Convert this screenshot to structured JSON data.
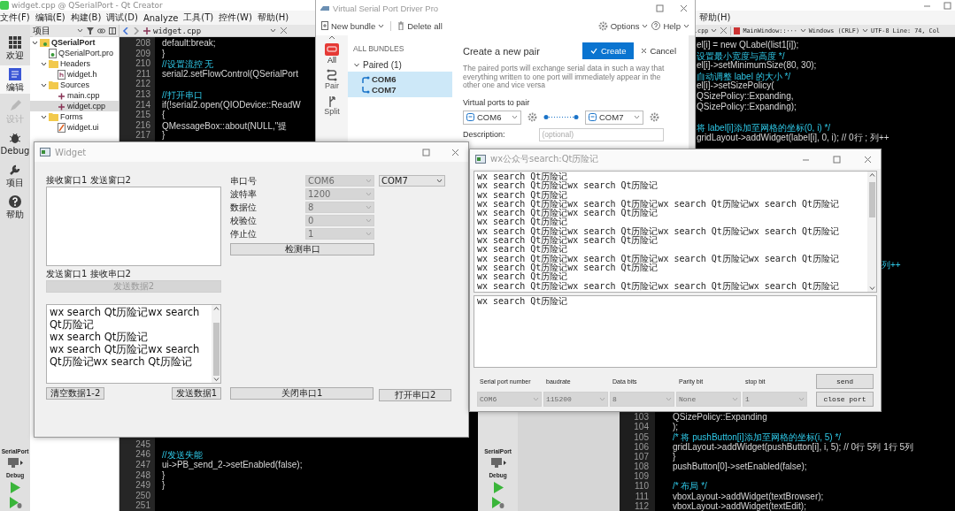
{
  "ide_left": {
    "title": "widget.cpp @ QSerialPort - Qt Creator",
    "menu": [
      "文件(F)",
      "编辑(E)",
      "构建(B)",
      "调试(D)",
      "Analyze",
      "工具(T)",
      "控件(W)",
      "帮助(H)"
    ],
    "modes": [
      {
        "label": "欢迎",
        "selected": false,
        "disabled": false
      },
      {
        "label": "编辑",
        "selected": true,
        "disabled": false
      },
      {
        "label": "设计",
        "selected": false,
        "disabled": true
      },
      {
        "label": "Debug",
        "selected": false,
        "disabled": false
      },
      {
        "label": "项目",
        "selected": false,
        "disabled": false
      },
      {
        "label": "帮助",
        "selected": false,
        "disabled": false
      }
    ],
    "project_view": "项目",
    "editor_file": "widget.cpp",
    "tree": [
      {
        "label": "QSerialPort",
        "kind": "project",
        "expanded": true,
        "selected": false,
        "children": [
          {
            "label": "QSerialPort.pro",
            "kind": "pro",
            "selected": false
          },
          {
            "label": "Headers",
            "kind": "folder",
            "expanded": true,
            "selected": false,
            "children": [
              {
                "label": "widget.h",
                "kind": "header",
                "selected": false
              }
            ]
          },
          {
            "label": "Sources",
            "kind": "folder",
            "expanded": true,
            "selected": false,
            "children": [
              {
                "label": "main.cpp",
                "kind": "source",
                "selected": false
              },
              {
                "label": "widget.cpp",
                "kind": "source",
                "selected": true
              }
            ]
          },
          {
            "label": "Forms",
            "kind": "folder",
            "expanded": true,
            "selected": false,
            "children": [
              {
                "label": "widget.ui",
                "kind": "form",
                "selected": false
              }
            ]
          }
        ]
      }
    ],
    "code_top": [
      {
        "number": "208",
        "kind": "code",
        "text": "default:break;"
      },
      {
        "number": "209",
        "kind": "code",
        "text": "}"
      },
      {
        "number": "210",
        "kind": "comment",
        "text": "//设置流控 无"
      },
      {
        "number": "211",
        "kind": "code",
        "text": "serial2.setFlowControl(QSerialPort"
      },
      {
        "number": "212",
        "kind": "blank"
      },
      {
        "number": "213",
        "kind": "comment",
        "text": "//打开串口"
      },
      {
        "number": "214",
        "kind": "code",
        "text": "if(!serial2.open(QIODevice::ReadW"
      },
      {
        "number": "215",
        "kind": "code",
        "text": "{"
      },
      {
        "number": "216",
        "kind": "code",
        "text": "QMessageBox::about(NULL,\"提"
      },
      {
        "number": "217",
        "kind": "code",
        "text": "}"
      }
    ],
    "code_bottom": [
      {
        "number": "245",
        "kind": "blank"
      },
      {
        "number": "246",
        "kind": "comment",
        "text": "//发送失能"
      },
      {
        "number": "247",
        "kind": "code",
        "text": "ui->PB_send_2->setEnabled(false);"
      },
      {
        "number": "248",
        "kind": "code",
        "text": "}"
      },
      {
        "number": "249",
        "kind": "code",
        "text": "}"
      },
      {
        "number": "250",
        "kind": "blank"
      },
      {
        "number": "251",
        "kind": "blank"
      }
    ],
    "kit": {
      "project": "SerialPort",
      "build": "Debug"
    }
  },
  "ide_right": {
    "menu": [
      "帮助(H)"
    ],
    "file_tab": ".cpp",
    "symbol": "MainWindow::···",
    "line_ending": "Windows (CRLF)",
    "position": "UTF-8 Line: 74, Col",
    "code_top": [
      {
        "kind": "code",
        "text": "el[i] = new QLabel(list1[i]);"
      },
      {
        "kind": "comment",
        "text": "设置最小宽度与高度 */"
      },
      {
        "kind": "code",
        "text": "el[i]->setMinimumSize(80, 30);"
      },
      {
        "kind": "comment",
        "text": "自动调整 label 的大小 */"
      },
      {
        "kind": "code",
        "text": "el[i]->setSizePolicy("
      },
      {
        "kind": "code",
        "text": "QSizePolicy::Expanding,"
      },
      {
        "kind": "code",
        "text": "QSizePolicy::Expanding);"
      },
      {
        "kind": "blank"
      },
      {
        "kind": "comment",
        "text": "将 label[i]添加至网格的坐标(0, i) */"
      },
      {
        "kind": "code",
        "text": "gridLayout->addWidget(label[i], 0, i); // 0行 ; 列++"
      }
    ],
    "fragment": "列++",
    "code_bottom": [
      {
        "number": "103",
        "kind": "code",
        "text": "QSizePolicy::Expanding"
      },
      {
        "number": "104",
        "kind": "code",
        "text": ");"
      },
      {
        "number": "105",
        "kind": "comment",
        "text": "/* 将 pushButton[i]添加至网格的坐标(i, 5) */"
      },
      {
        "number": "106",
        "kind": "code",
        "text": "gridLayout->addWidget(pushButton[i], i, 5); // 0行 5列 1行 5列"
      },
      {
        "number": "107",
        "kind": "code",
        "text": "}"
      },
      {
        "number": "108",
        "kind": "code",
        "text": "pushButton[0]->setEnabled(false);"
      },
      {
        "number": "109",
        "kind": "blank"
      },
      {
        "number": "110",
        "kind": "comment",
        "text": "/* 布局 */"
      },
      {
        "number": "111",
        "kind": "code",
        "text": "vboxLayout->addWidget(textBrowser);"
      },
      {
        "number": "112",
        "kind": "code",
        "text": "vboxLayout->addWidget(textEdit);"
      }
    ],
    "kit": {
      "project": "SerialPort",
      "build": "Debug"
    }
  },
  "vspd": {
    "title": "Virtual Serial Port Driver Pro",
    "new_bundle": "New bundle",
    "delete_all": "Delete all",
    "options": "Options",
    "help": "Help",
    "nav": [
      {
        "label": "All",
        "selected": true
      },
      {
        "label": "Pair",
        "selected": false
      },
      {
        "label": "Split",
        "selected": false
      }
    ],
    "bundles_heading": "ALL BUNDLES",
    "bundle": {
      "label": "Paired (1)",
      "expanded": true,
      "selected": true,
      "ports": [
        "COM6",
        "COM7"
      ]
    },
    "heading": "Create a new pair",
    "create": "Create",
    "cancel": "Cancel",
    "description": "The paired ports will exchange serial data in such a way that everything written to one port will immediately appear in the other one and vice versa",
    "ports_label": "Virtual ports to pair",
    "port_a": "COM6",
    "port_b": "COM7",
    "description_label": "Description:",
    "description_placeholder": "(optional)"
  },
  "widget": {
    "title": "Widget",
    "receive_label": "接收窗口1 发送窗口2",
    "send_label": "发送窗口1 接收串口2",
    "send2": {
      "label": "发送数据2",
      "disabled": true
    },
    "text_edit": [
      "wx search Qt历险记wx search Qt历险记",
      "wx search Qt历险记",
      "wx search Qt历险记wx search Qt历险记wx search Qt历险记"
    ],
    "settings": [
      {
        "label": "串口号",
        "value": "COM6",
        "disabled": true
      },
      {
        "label": "波特率",
        "value": "1200",
        "disabled": true
      },
      {
        "label": "数据位",
        "value": "8",
        "disabled": true
      },
      {
        "label": "校验位",
        "value": "0",
        "disabled": true
      },
      {
        "label": "停止位",
        "value": "1",
        "disabled": true
      }
    ],
    "port2": {
      "value": "COM7",
      "disabled": false
    },
    "detect": "检测串口",
    "clear": "清空数据1-2",
    "send1": "发送数据1",
    "close1": "关闭串口1",
    "open2": "打开串口2"
  },
  "wx": {
    "title": "wx公众号search:Qt历险记",
    "received": [
      "wx search Qt历险记",
      "wx search Qt历险记wx search Qt历险记",
      "wx search Qt历险记",
      "wx search Qt历险记wx search Qt历险记wx search Qt历险记wx search Qt历险记",
      "wx search Qt历险记wx search Qt历险记",
      "wx search Qt历险记",
      "wx search Qt历险记wx search Qt历险记wx search Qt历险记wx search Qt历险记",
      "wx search Qt历险记wx search Qt历险记",
      "wx search Qt历险记",
      "wx search Qt历险记wx search Qt历险记wx search Qt历险记wx search Qt历险记",
      "wx search Qt历险记wx search Qt历险记",
      "wx search Qt历险记",
      "wx search Qt历险记wx search Qt历险记wx search Qt历险记wx search Qt历险记"
    ],
    "input": "wx search Qt历险记",
    "fields": [
      {
        "label": "Serial port number",
        "value": "COM6",
        "disabled": true
      },
      {
        "label": "baudrate",
        "value": "115200",
        "disabled": true
      },
      {
        "label": "Data bits",
        "value": "8",
        "disabled": true
      },
      {
        "label": "Parity bit",
        "value": "None",
        "disabled": true
      },
      {
        "label": "stop bit",
        "value": "1",
        "disabled": true
      }
    ],
    "send": "send",
    "close": "close port"
  }
}
